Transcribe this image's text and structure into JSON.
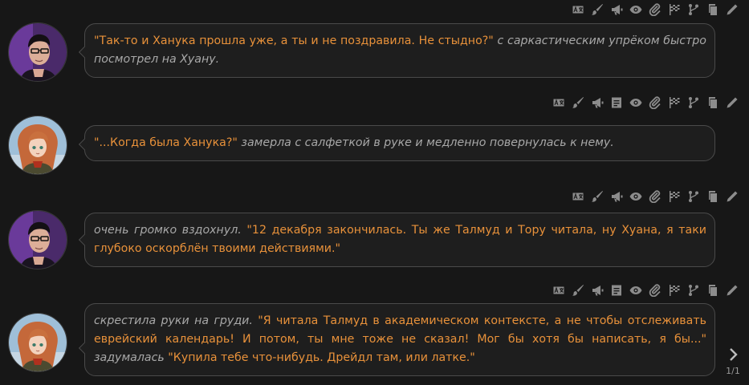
{
  "toolbar_icons": {
    "translate": "translate-icon",
    "brush": "paintbrush-icon",
    "narrate": "megaphone-icon",
    "summary": "summary-icon",
    "hide": "eye-icon",
    "attach": "paperclip-icon",
    "checkpoint": "flag-icon",
    "branch": "branch-icon",
    "copy": "copy-icon",
    "edit": "pencil-icon"
  },
  "messages": [
    {
      "speaker": "male",
      "parts": [
        {
          "t": "\"Так-то и Ханука прошла уже, а ты и не поздравила. Не стыдно?\"",
          "s": "q"
        },
        {
          "t": " с саркастическим упрёком быстро посмотрел на Хуану.",
          "s": "n"
        }
      ]
    },
    {
      "speaker": "female",
      "parts": [
        {
          "t": "\"...Когда была Ханука?\"",
          "s": "q"
        },
        {
          "t": " замерла с салфеткой в руке и медленно повернулась к нему.",
          "s": "n"
        }
      ]
    },
    {
      "speaker": "male",
      "parts": [
        {
          "t": "очень громко вздохнул.",
          "s": "n"
        },
        {
          "t": " \"12 декабря закончилась. Ты же Талмуд и Тору читала, ну Хуана, я таки глубоко оскорблён твоими действиями.\"",
          "s": "q"
        }
      ]
    },
    {
      "speaker": "female",
      "parts": [
        {
          "t": "скрестила руки на груди.",
          "s": "n"
        },
        {
          "t": " \"Я читала Талмуд в академическом контексте, а не чтобы отслеживать еврейский календарь! И потом, ты мне тоже не сказал! Мог бы хотя бы написать, я бы...\"",
          "s": "q"
        },
        {
          "t": " задумалась",
          "s": "n"
        },
        {
          "t": " \"Купила тебе что-нибудь. Дрейдл там, или латке.\"",
          "s": "q"
        }
      ]
    }
  ],
  "pager": {
    "label": "1/1",
    "icon": "chevron-right-icon"
  },
  "colors": {
    "background": "#171717",
    "bubble": "#1e1e1e",
    "quote": "#e8913a",
    "narration": "#a8a8a8",
    "icon": "#8c8c8c"
  }
}
